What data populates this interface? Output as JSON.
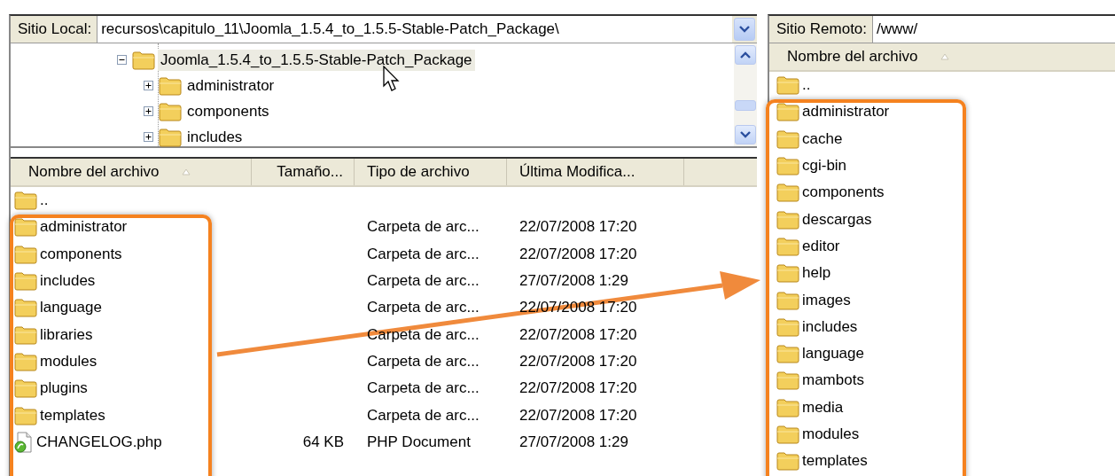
{
  "local": {
    "label": "Sitio Local:",
    "path": "recursos\\capitulo_11\\Joomla_1.5.4_to_1.5.5-Stable-Patch_Package\\",
    "tree": {
      "name": "Joomla_1.5.4_to_1.5.5-Stable-Patch_Package",
      "expanded": true,
      "selected": true,
      "children": [
        {
          "name": "administrator",
          "expanded": false
        },
        {
          "name": "components",
          "expanded": false
        },
        {
          "name": "includes",
          "expanded": false
        }
      ]
    },
    "columns": [
      {
        "label": "Nombre del archivo",
        "sorted": true
      },
      {
        "label": "Tamaño...",
        "sorted": false
      },
      {
        "label": "Tipo de archivo",
        "sorted": false
      },
      {
        "label": "Última Modifica...",
        "sorted": false
      }
    ],
    "rows": [
      {
        "kind": "folder",
        "name": ".."
      },
      {
        "kind": "folder",
        "name": "administrator",
        "type": "Carpeta de arc...",
        "modified": "22/07/2008 17:20"
      },
      {
        "kind": "folder",
        "name": "components",
        "type": "Carpeta de arc...",
        "modified": "22/07/2008 17:20"
      },
      {
        "kind": "folder",
        "name": "includes",
        "type": "Carpeta de arc...",
        "modified": "27/07/2008 1:29"
      },
      {
        "kind": "folder",
        "name": "language",
        "type": "Carpeta de arc...",
        "modified": "22/07/2008 17:20"
      },
      {
        "kind": "folder",
        "name": "libraries",
        "type": "Carpeta de arc...",
        "modified": "22/07/2008 17:20"
      },
      {
        "kind": "folder",
        "name": "modules",
        "type": "Carpeta de arc...",
        "modified": "22/07/2008 17:20"
      },
      {
        "kind": "folder",
        "name": "plugins",
        "type": "Carpeta de arc...",
        "modified": "22/07/2008 17:20"
      },
      {
        "kind": "folder",
        "name": "templates",
        "type": "Carpeta de arc...",
        "modified": "22/07/2008 17:20"
      },
      {
        "kind": "file",
        "name": "CHANGELOG.php",
        "size": "64 KB",
        "type": "PHP Document",
        "modified": "27/07/2008 1:29"
      }
    ]
  },
  "remote": {
    "label": "Sitio Remoto:",
    "path": "/www/",
    "columns": [
      {
        "label": "Nombre del archivo",
        "sorted": true
      }
    ],
    "rows": [
      {
        "kind": "folder",
        "name": ".."
      },
      {
        "kind": "folder",
        "name": "administrator"
      },
      {
        "kind": "folder",
        "name": "cache"
      },
      {
        "kind": "folder",
        "name": "cgi-bin"
      },
      {
        "kind": "folder",
        "name": "components"
      },
      {
        "kind": "folder",
        "name": "descargas"
      },
      {
        "kind": "folder",
        "name": "editor"
      },
      {
        "kind": "folder",
        "name": "help"
      },
      {
        "kind": "folder",
        "name": "images"
      },
      {
        "kind": "folder",
        "name": "includes"
      },
      {
        "kind": "folder",
        "name": "language"
      },
      {
        "kind": "folder",
        "name": "mambots"
      },
      {
        "kind": "folder",
        "name": "media"
      },
      {
        "kind": "folder",
        "name": "modules"
      },
      {
        "kind": "folder",
        "name": "templates"
      }
    ]
  }
}
